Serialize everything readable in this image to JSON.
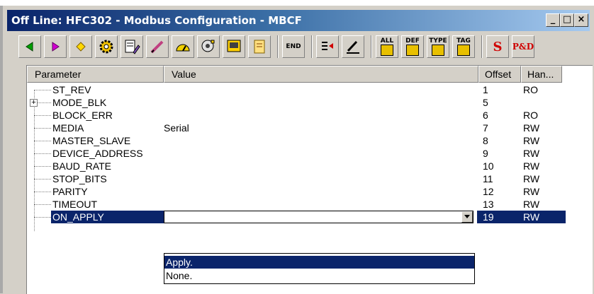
{
  "window": {
    "title": "Off Line: HFC302 - Modbus Configuration - MBCF",
    "minimize": "_",
    "maximize": "□",
    "close": "×"
  },
  "toolbar": {
    "buttons": [
      {
        "name": "back-arrow-icon"
      },
      {
        "name": "forward-arrow-icon"
      },
      {
        "name": "diamond-icon"
      },
      {
        "name": "gear-icon"
      },
      {
        "name": "edit-document-icon"
      },
      {
        "name": "pencil-icon"
      },
      {
        "name": "gauge-icon"
      },
      {
        "name": "speaker-icon"
      },
      {
        "name": "monitor-icon"
      },
      {
        "name": "scroll-icon"
      },
      {
        "name": "end-icon",
        "label": "END"
      },
      {
        "name": "list-arrow-icon"
      },
      {
        "name": "write-icon"
      },
      {
        "name": "all-block-icon",
        "label": "ALL"
      },
      {
        "name": "def-block-icon",
        "label": "DEF"
      },
      {
        "name": "type-block-icon",
        "label": "TYPE"
      },
      {
        "name": "tag-block-icon",
        "label": "TAG"
      },
      {
        "name": "sf-icon",
        "label": "S"
      },
      {
        "name": "pd-icon",
        "label": "P&D"
      }
    ]
  },
  "grid": {
    "columns": {
      "parameter": "Parameter",
      "value": "Value",
      "offset": "Offset",
      "handling": "Han..."
    },
    "rows": [
      {
        "name": "ST_REV",
        "value": "",
        "offset": "1",
        "handling": "RO"
      },
      {
        "name": "MODE_BLK",
        "value": "",
        "offset": "5",
        "handling": "",
        "expandable": true
      },
      {
        "name": "BLOCK_ERR",
        "value": "",
        "offset": "6",
        "handling": "RO"
      },
      {
        "name": "MEDIA",
        "value": "Serial",
        "offset": "7",
        "handling": "RW"
      },
      {
        "name": "MASTER_SLAVE",
        "value": "",
        "offset": "8",
        "handling": "RW"
      },
      {
        "name": "DEVICE_ADDRESS",
        "value": "",
        "offset": "9",
        "handling": "RW"
      },
      {
        "name": "BAUD_RATE",
        "value": "",
        "offset": "10",
        "handling": "RW"
      },
      {
        "name": "STOP_BITS",
        "value": "",
        "offset": "11",
        "handling": "RW"
      },
      {
        "name": "PARITY",
        "value": "",
        "offset": "12",
        "handling": "RW"
      },
      {
        "name": "TIMEOUT",
        "value": "",
        "offset": "13",
        "handling": "RW"
      },
      {
        "name": "ON_APPLY",
        "value": "",
        "offset": "19",
        "handling": "RW",
        "selected": true
      }
    ],
    "dropdown_options": [
      "Apply.",
      "None."
    ],
    "highlighted_option": "Apply."
  },
  "colors": {
    "title_start": "#0a246a",
    "title_end": "#a6caf0",
    "selection": "#0a246a",
    "face": "#d4d0c8"
  }
}
